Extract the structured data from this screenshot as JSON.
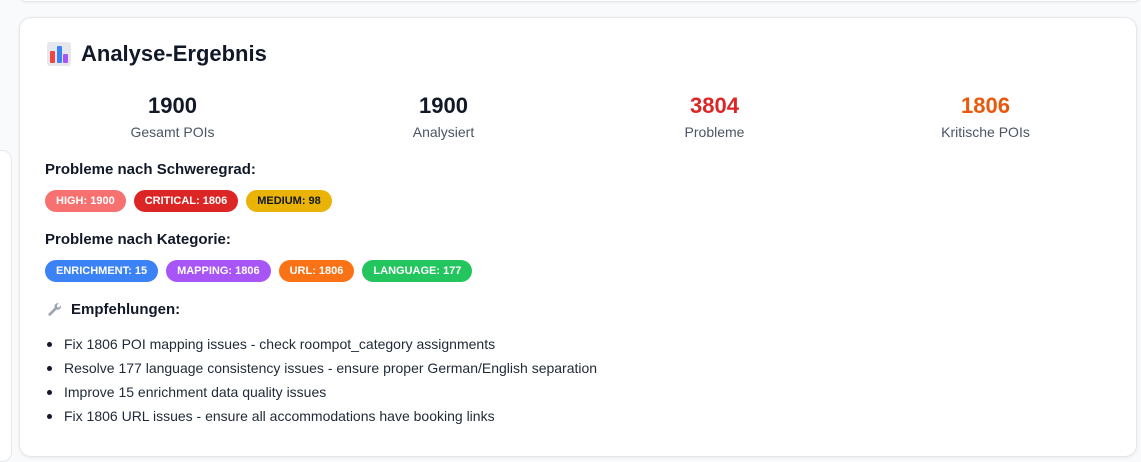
{
  "card": {
    "title": "Analyse-Ergebnis",
    "icon": "bar-chart-icon"
  },
  "stats": [
    {
      "value": "1900",
      "label": "Gesamt POIs",
      "color": "#111827"
    },
    {
      "value": "1900",
      "label": "Analysiert",
      "color": "#111827"
    },
    {
      "value": "3804",
      "label": "Probleme",
      "color": "#dc2626"
    },
    {
      "value": "1806",
      "label": "Kritische POIs",
      "color": "#ea580c"
    }
  ],
  "severity": {
    "heading": "Probleme nach Schweregrad:",
    "badges": [
      {
        "label": "HIGH: 1900",
        "color": "#f87171",
        "text_color": "#ffffff"
      },
      {
        "label": "CRITICAL: 1806",
        "color": "#dc2626",
        "text_color": "#ffffff"
      },
      {
        "label": "MEDIUM: 98",
        "color": "#eab308",
        "text_color": "#111827"
      }
    ]
  },
  "category": {
    "heading": "Probleme nach Kategorie:",
    "badges": [
      {
        "label": "ENRICHMENT: 15",
        "color": "#3b82f6",
        "text_color": "#ffffff"
      },
      {
        "label": "MAPPING: 1806",
        "color": "#a855f7",
        "text_color": "#ffffff"
      },
      {
        "label": "URL: 1806",
        "color": "#f97316",
        "text_color": "#ffffff"
      },
      {
        "label": "LANGUAGE: 177",
        "color": "#22c55e",
        "text_color": "#ffffff"
      }
    ]
  },
  "recommendations": {
    "heading": "Empfehlungen:",
    "icon": "wrench-icon",
    "items": [
      "Fix 1806 POI mapping issues - check roompot_category assignments",
      "Resolve 177 language consistency issues - ensure proper German/English separation",
      "Improve 15 enrichment data quality issues",
      "Fix 1806 URL issues - ensure all accommodations have booking links"
    ]
  }
}
